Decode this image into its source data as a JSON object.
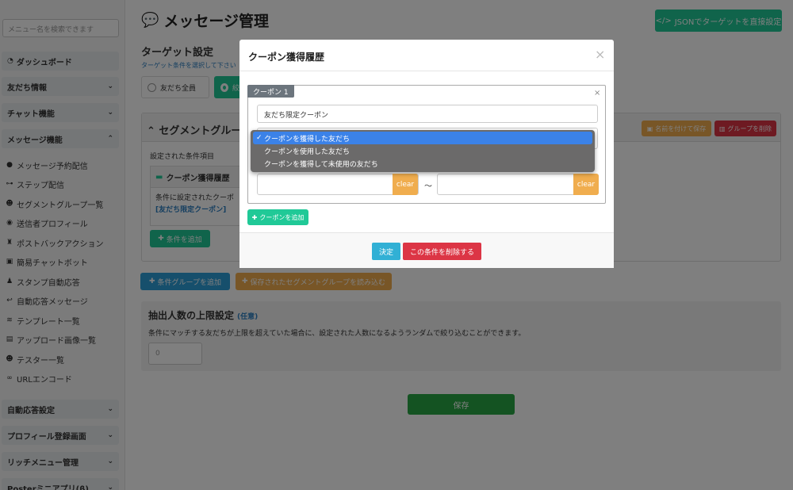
{
  "sidebar": {
    "search_placeholder": "メニュー名を検索できます",
    "dashboard": "ダッシュボード",
    "friends": "友だち情報",
    "chat": "チャット機能",
    "message": "メッセージ機能",
    "sub_items": [
      "メッセージ予約配信",
      "ステップ配信",
      "セグメントグループ一覧",
      "送信者プロフィール",
      "ポストバックアクション",
      "簡易チャットボット",
      "スタンプ自動応答",
      "自動応答メッセージ",
      "テンプレート一覧",
      "アップロード画像一覧",
      "テスター一覧",
      "URLエンコード"
    ],
    "auto_reply": "自動応答設定",
    "profile_reg": "プロフィール登録画面",
    "rich_menu": "リッチメニュー管理",
    "poster": "Posterミニアプリ(β)"
  },
  "main": {
    "title": "メッセージ管理",
    "json_button": "JSONでターゲットを直接設定",
    "target_title": "ターゲット設定",
    "target_sub": "ターゲット条件を選択して下さい",
    "radio_all": "友だち全員",
    "radio_filter": "絞",
    "segment_title": "セグメントグルー",
    "name_save": "名前を付けて保存",
    "group_delete": "グループを削除",
    "set_conditions": "設定された条件項目",
    "cond_card_title": "クーポン獲得履歴",
    "cond_card_text": "条件に設定されたクーポ",
    "cond_card_link": "[友だち限定クーポン]",
    "add_condition": "条件を追加",
    "add_group": "条件グループを追加",
    "load_group": "保存されたセグメントグループを読み込む",
    "limit_title": "抽出人数の上限設定",
    "limit_optional": "(任意)",
    "limit_desc": "条件にマッチする友だちが上限を超えていた場合に、設定された人数になるようランダムで絞り込むことができます。",
    "limit_value": "0",
    "save": "保存"
  },
  "modal": {
    "title": "クーポン獲得履歴",
    "close": "×",
    "coupon_tag": "クーポン 1",
    "coupon_close": "×",
    "coupon_name": "友だち限定クーポン",
    "clear1": "clear",
    "tilde": "〜",
    "clear2": "clear",
    "add_coupon": "クーポンを追加",
    "ok": "決定",
    "delete": "この条件を削除する"
  },
  "dropdown": {
    "options": [
      "クーポンを獲得した友だち",
      "クーポンを使用した友だち",
      "クーポンを獲得して未使用の友だち"
    ],
    "selected_index": 0
  },
  "colors": {
    "green": "#20c997",
    "blue": "#2d9ed8",
    "orange": "#f0ad4e",
    "red": "#dc3545",
    "select_blue": "#3b82e8"
  }
}
